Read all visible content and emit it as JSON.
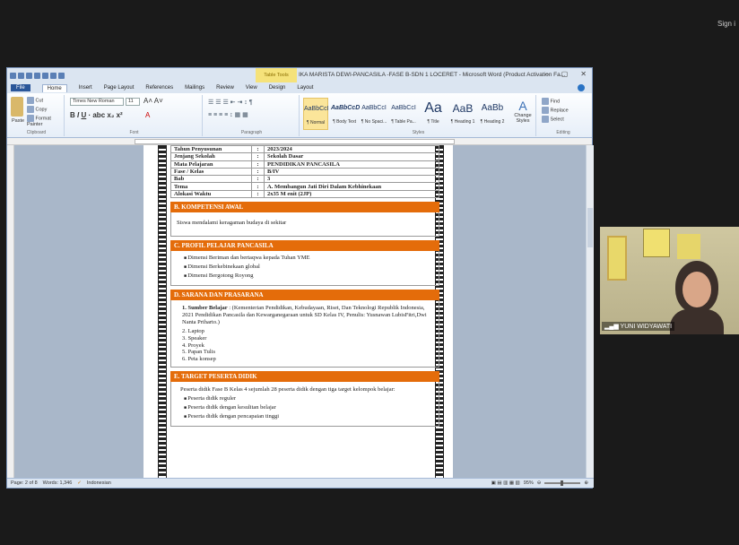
{
  "meeting": {
    "top_right_label": "Sign i",
    "participant_name": "YUNI WIDYAWATI"
  },
  "word": {
    "title": "IKA MARISTA DEWI-PANCASILA -FASE B-SDN 1 LOCERET - Microsoft Word (Product Activation Fa...",
    "context_tab": "Table Tools",
    "window_controls": [
      "–",
      "▢",
      "✕"
    ],
    "tabs": [
      "File",
      "Home",
      "Insert",
      "Page Layout",
      "References",
      "Mailings",
      "Review",
      "View",
      "Design",
      "Layout"
    ],
    "clipboard": {
      "paste": "Paste",
      "cut": "Cut",
      "copy": "Copy",
      "format_painter": "Format Painter",
      "label": "Clipboard"
    },
    "font": {
      "name": "Times New Roman",
      "size": "11",
      "label": "Font"
    },
    "paragraph": {
      "label": "Paragraph"
    },
    "styles": {
      "label": "Styles",
      "items": [
        {
          "sample": "AaBbCcI",
          "name": "¶ Normal"
        },
        {
          "sample": "AaBbCcD",
          "name": "¶ Body Text"
        },
        {
          "sample": "AaBbCcI",
          "name": "¶ No Spaci..."
        },
        {
          "sample": "AaBbCcI",
          "name": "¶ Table Pa..."
        },
        {
          "sample": "Aa",
          "name": "¶ Title"
        },
        {
          "sample": "AaB",
          "name": "¶ Heading 1"
        },
        {
          "sample": "AaBb",
          "name": "¶ Heading 2"
        }
      ],
      "change": "Change Styles"
    },
    "editing": {
      "find": "Find",
      "replace": "Replace",
      "select": "Select",
      "label": "Editing"
    },
    "status": {
      "page": "Page: 2 of 8",
      "words": "Words: 1,346",
      "language": "Indonesian",
      "zoom": "95%"
    }
  },
  "document": {
    "info_rows": [
      {
        "label": "Tahun Penyusunan",
        "colon": ":",
        "value": "2023/2024"
      },
      {
        "label": "Jenjang Sekolah",
        "colon": ":",
        "value": "Sekolah Dasar"
      },
      {
        "label": "Mata Pelajaran",
        "colon": ":",
        "value": "PENDIDIKAN PANCASILA"
      },
      {
        "label": "Fase / Kelas",
        "colon": ":",
        "value": "B/IV"
      },
      {
        "label": "Bab",
        "colon": ":",
        "value": "3"
      },
      {
        "label": "Tema",
        "colon": ":",
        "value": "A. Membangun Jati Diri Dalam Kebhinekaan"
      },
      {
        "label": "Alokasi Waktu",
        "colon": ":",
        "value": "2x35 M enit (2JP)"
      }
    ],
    "kompetensi": {
      "title": "B. KOMPETENSI AWAL",
      "text": "Siswa mendalami keragaman budaya di sekitar"
    },
    "profil": {
      "title": "C. PROFIL PELAJAR PANCASILA",
      "items": [
        "Dimensi Beriman dan bertaqwa kepada Tuhan YME",
        "Dimensi Berkebinekaan global",
        "Dimensi Bergotong Royong"
      ]
    },
    "sarana": {
      "title": "D. SARANA DAN PRASARANA",
      "item1_label": "1. Sumber Belajar",
      "item1_text": ": (Kementerian Pendidikan, Kebudayaan, Riset, Dan Teknologi Republik Indonesia, 2021 Pendidikan Pancasila dan Kewarganegaraan untuk SD Kelas IV, Penulis: Yusnawan LubisFitri,Dwi Nanta Priharto.)",
      "items": [
        "2. Laptop",
        "3. Speaker",
        "4. Proyek",
        "5. Papan Tulis",
        "6. Peta konsep"
      ]
    },
    "target": {
      "title": "E. TARGET PESERTA DIDIK",
      "intro": "Peserta didik Fase B Kelas 4 sejumlah 28 peserta didik dengan tiga target kelompok belajar:",
      "items": [
        "Peserta didik reguler",
        "Peserta didik dengan kesulitan belajar",
        "Peserta didik dengan pencapaian tinggi"
      ]
    }
  }
}
